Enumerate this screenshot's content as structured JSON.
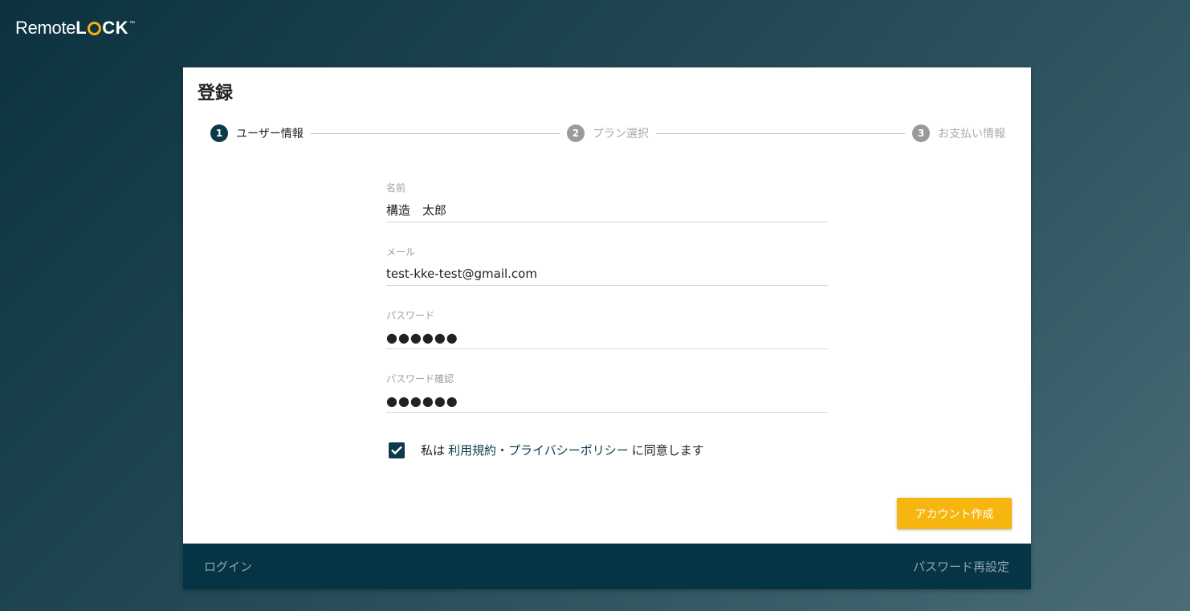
{
  "brand": {
    "logo_remote": "Remote",
    "logo_lock_l": "L",
    "logo_lock_ck": "CK",
    "logo_tm": "™"
  },
  "card": {
    "title": "登録"
  },
  "stepper": {
    "steps": [
      {
        "number": "1",
        "label": "ユーザー情報",
        "state": "active"
      },
      {
        "number": "2",
        "label": "プラン選択",
        "state": "inactive"
      },
      {
        "number": "3",
        "label": "お支払い情報",
        "state": "inactive"
      }
    ]
  },
  "form": {
    "name": {
      "label": "名前",
      "value": "構造　太郎"
    },
    "email": {
      "label": "メール",
      "value": "test-kke-test@gmail.com"
    },
    "password": {
      "label": "パスワード",
      "value": "●●●●●●"
    },
    "password_confirm": {
      "label": "パスワード確認",
      "value": "●●●●●●"
    },
    "agree": {
      "checked": true,
      "prefix": "私は",
      "link": "利用規約・プライバシーポリシー",
      "suffix": "に同意します"
    },
    "submit_label": "アカウント作成"
  },
  "footer": {
    "login_link": "ログイン",
    "reset_link": "パスワード再設定"
  },
  "colors": {
    "primary": "#0c3a4a",
    "accent": "#f7b50f",
    "footer_bg": "#053444"
  }
}
